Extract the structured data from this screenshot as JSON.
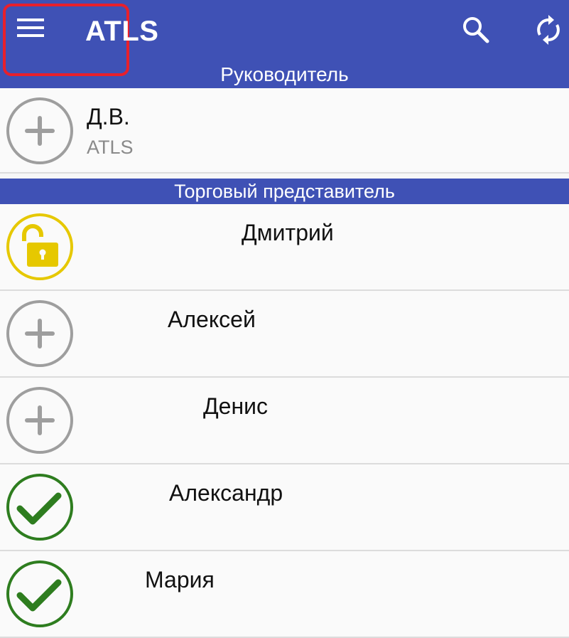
{
  "app_bar": {
    "title": "ATLS",
    "subtitle": "Руководитель",
    "menu_icon": "hamburger-menu-icon",
    "search_icon": "search-icon",
    "sync_icon": "sync-icon",
    "color": "#3f51b5"
  },
  "manager": {
    "name": "Д.В.",
    "company": "ATLS",
    "status": "add"
  },
  "section": {
    "title": "Торговый представитель"
  },
  "reps": [
    {
      "name": "Дмитрий",
      "status": "unlocked"
    },
    {
      "name": "Алексей",
      "status": "add"
    },
    {
      "name": "Денис",
      "status": "add"
    },
    {
      "name": "Александр",
      "status": "done"
    },
    {
      "name": "Мария",
      "status": "done"
    }
  ],
  "colors": {
    "add": "#9e9e9e",
    "unlocked": "#e6c800",
    "done": "#2e7d1f",
    "highlight": "#e8202c"
  }
}
